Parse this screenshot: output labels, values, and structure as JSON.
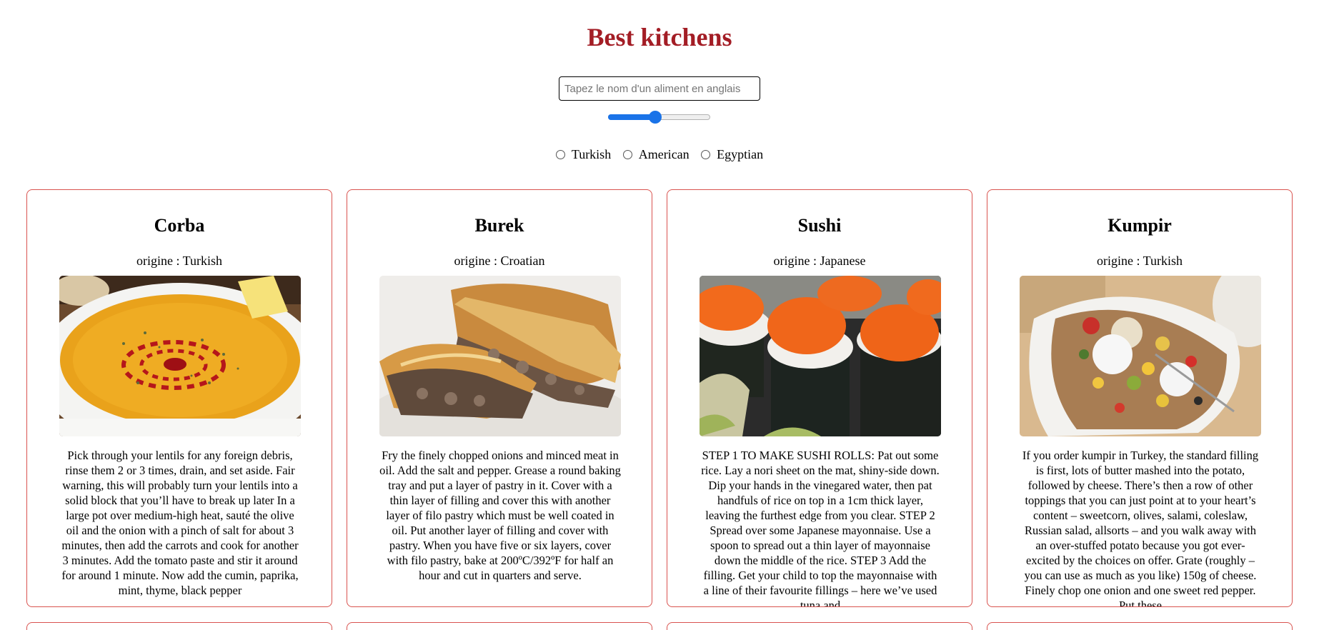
{
  "header": {
    "title": "Best kitchens"
  },
  "search": {
    "placeholder": "Tapez le nom d'un aliment en anglais",
    "value": ""
  },
  "slider": {
    "fraction": 0.46
  },
  "filters": {
    "options": [
      "Turkish",
      "American",
      "Egyptian"
    ]
  },
  "colors": {
    "title": "#a31d25",
    "card_border": "#d9534f",
    "slider_accent": "#1a73e8"
  },
  "origin_prefix": "origine : ",
  "cards": [
    {
      "name": "Corba",
      "origin": "Turkish",
      "description": "Pick through your lentils for any foreign debris, rinse them 2 or 3 times, drain, and set aside. Fair warning, this will probably turn your lentils into a solid block that you’ll have to break up later In a large pot over medium-high heat, sauté the olive oil and the onion with a pinch of salt for about 3 minutes, then add the carrots and cook for another 3 minutes. Add the tomato paste and stir it around for around 1 minute. Now add the cumin, paprika, mint, thyme, black pepper"
    },
    {
      "name": "Burek",
      "origin": "Croatian",
      "description": "Fry the finely chopped onions and minced meat in oil. Add the salt and pepper. Grease a round baking tray and put a layer of pastry in it. Cover with a thin layer of filling and cover this with another layer of filo pastry which must be well coated in oil. Put another layer of filling and cover with pastry. When you have five or six layers, cover with filo pastry, bake at 200ºC/392ºF for half an hour and cut in quarters and serve."
    },
    {
      "name": "Sushi",
      "origin": "Japanese",
      "description": "STEP 1 TO MAKE SUSHI ROLLS: Pat out some rice. Lay a nori sheet on the mat, shiny-side down. Dip your hands in the vinegared water, then pat handfuls of rice on top in a 1cm thick layer, leaving the furthest edge from you clear. STEP 2 Spread over some Japanese mayonnaise. Use a spoon to spread out a thin layer of mayonnaise down the middle of the rice. STEP 3 Add the filling. Get your child to top the mayonnaise with a line of their favourite fillings – here we’ve used tuna and"
    },
    {
      "name": "Kumpir",
      "origin": "Turkish",
      "description": "If you order kumpir in Turkey, the standard filling is first, lots of butter mashed into the potato, followed by cheese. There’s then a row of other toppings that you can just point at to your heart’s content – sweetcorn, olives, salami, coleslaw, Russian salad, allsorts – and you walk away with an over-stuffed potato because you got ever-excited by the choices on offer. Grate (roughly – you can use as much as you like) 150g of cheese. Finely chop one onion and one sweet red pepper. Put these"
    }
  ]
}
